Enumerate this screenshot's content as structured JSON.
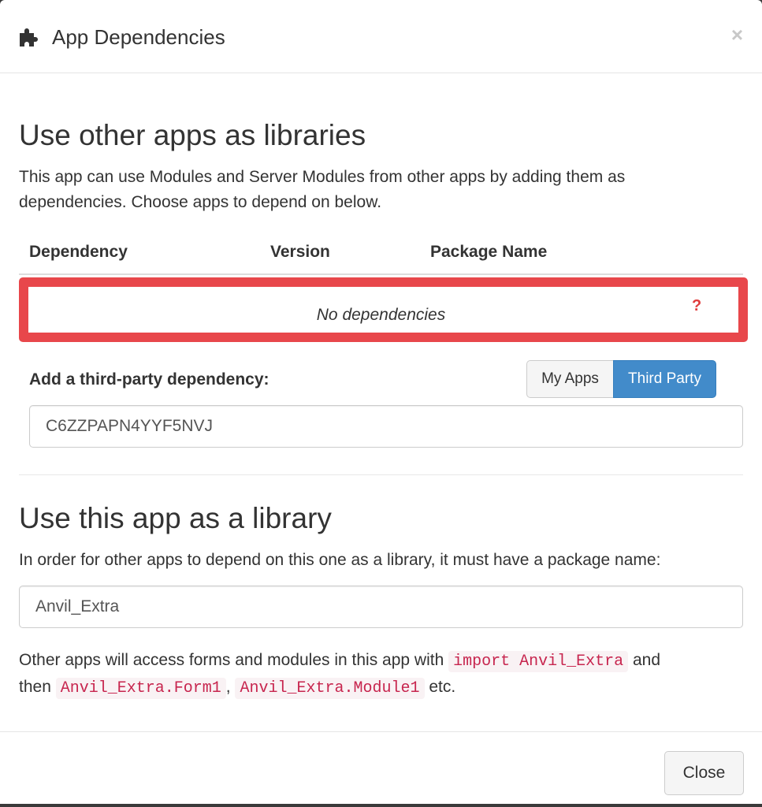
{
  "header": {
    "icon": "puzzle-icon",
    "title": "App Dependencies",
    "close_icon": "close-icon",
    "close_glyph": "×"
  },
  "section_libraries": {
    "heading": "Use other apps as libraries",
    "description": "This app can use Modules and Server Modules from other apps by adding them as dependencies. Choose apps to depend on below.",
    "table": {
      "columns": [
        "Dependency",
        "Version",
        "Package Name"
      ],
      "empty_text": "No dependencies",
      "help_glyph": "?"
    },
    "add_label": "Add a third-party dependency:",
    "source_toggle": {
      "options": [
        "My Apps",
        "Third Party"
      ],
      "selected": "Third Party"
    },
    "dependency_input_value": "C6ZZPAPN4YYF5NVJ"
  },
  "section_library": {
    "heading": "Use this app as a library",
    "description": "In order for other apps to depend on this one as a library, it must have a package name:",
    "package_name_value": "Anvil_Extra",
    "usage_text_1": "Other apps will access forms and modules in this app with",
    "usage_code_1": "import Anvil_Extra",
    "usage_text_2": "and",
    "usage_text_3": "then",
    "usage_code_2": "Anvil_Extra.Form1",
    "usage_sep": ",",
    "usage_code_3": "Anvil_Extra.Module1",
    "usage_text_4": "etc."
  },
  "footer": {
    "close_label": "Close"
  },
  "colors": {
    "highlight": "#e8474b",
    "primary": "#428bca",
    "code_text": "#c7254e"
  }
}
